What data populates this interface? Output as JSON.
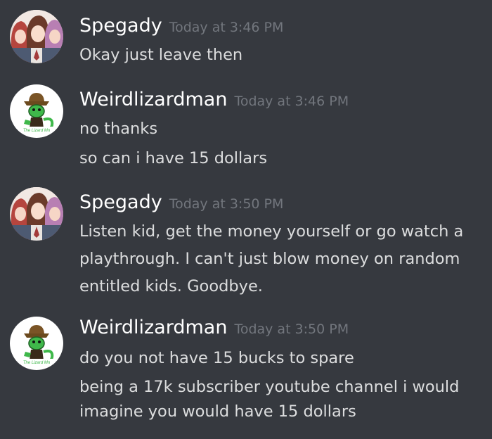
{
  "colors": {
    "background": "#36393f",
    "username": "#ffffff",
    "timestamp": "#72767d",
    "message_text": "#dcddde"
  },
  "messages": [
    {
      "author": "Spegady",
      "avatar_icon": "anime-girls-avatar-icon",
      "timestamp": "Today at 3:46 PM",
      "lines": [
        "Okay just leave then"
      ]
    },
    {
      "author": "Weirdlizardman",
      "avatar_icon": "lizard-cowboy-avatar-icon",
      "timestamp": "Today at 3:46 PM",
      "lines": [
        "no thanks",
        "so can i have 15 dollars"
      ]
    },
    {
      "author": "Spegady",
      "avatar_icon": "anime-girls-avatar-icon",
      "timestamp": "Today at 3:50 PM",
      "lines": [
        "Listen kid, get the money yourself or go watch a",
        "playthrough. I can't just blow money on random",
        "entitled kids. Goodbye."
      ]
    },
    {
      "author": "Weirdlizardman",
      "avatar_icon": "lizard-cowboy-avatar-icon",
      "timestamp": "Today at 3:50 PM",
      "lines": [
        "do you not have 15 bucks to spare",
        "being a 17k subscriber youtube channel i would",
        "imagine you would have 15 dollars"
      ]
    }
  ]
}
